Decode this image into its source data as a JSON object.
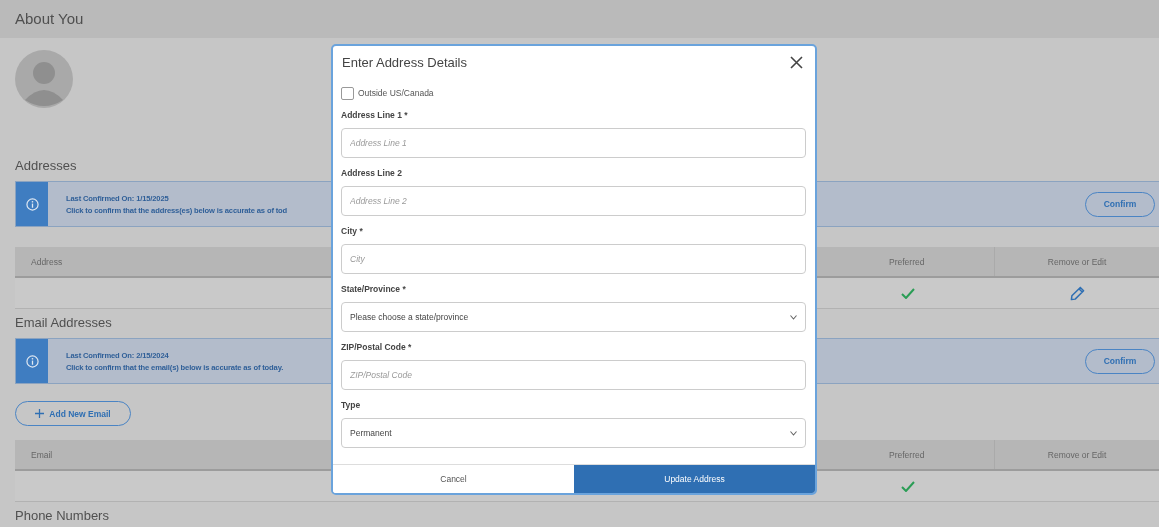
{
  "page": {
    "title": "About You"
  },
  "sections": [
    {
      "heading": "Addresses",
      "notice": {
        "title": "Last Confirmed On: 1/15/2025",
        "text": "Click to confirm that the address(es) below is accurate as of tod"
      },
      "confirm_button": "Confirm",
      "table": {
        "columns": [
          "Address",
          "Preferred",
          "Remove or Edit"
        ],
        "rows": [
          {
            "preferred": true,
            "editable": true
          }
        ]
      }
    },
    {
      "heading": "Email Addresses",
      "notice": {
        "title": "Last Confirmed On: 2/15/2024",
        "text": "Click to confirm that the email(s) below is accurate as of today."
      },
      "confirm_button": "Confirm",
      "add_button": "Add New Email",
      "table": {
        "columns": [
          "Email",
          "Preferred",
          "Remove or Edit"
        ],
        "rows": [
          {
            "preferred": true,
            "editable": false
          }
        ]
      }
    }
  ],
  "next_heading": "Phone Numbers",
  "dialog": {
    "title": "Enter Address Details",
    "fields": [
      {
        "kind": "checkbox",
        "label": "Outside US/Canada",
        "checked": false
      },
      {
        "kind": "text",
        "label": "Address Line 1 *",
        "placeholder": "Address Line 1"
      },
      {
        "kind": "text",
        "label": "Address Line 2",
        "placeholder": "Address Line 2"
      },
      {
        "kind": "text",
        "label": "City *",
        "placeholder": "City"
      },
      {
        "kind": "select",
        "label": "State/Province *",
        "value": "Please choose a state/province"
      },
      {
        "kind": "text",
        "label": "ZIP/Postal Code *",
        "placeholder": "ZIP/Postal Code"
      },
      {
        "kind": "select",
        "label": "Type",
        "value": "Permanent"
      }
    ],
    "cancel_button": "Cancel",
    "submit_button": "Update Address"
  }
}
